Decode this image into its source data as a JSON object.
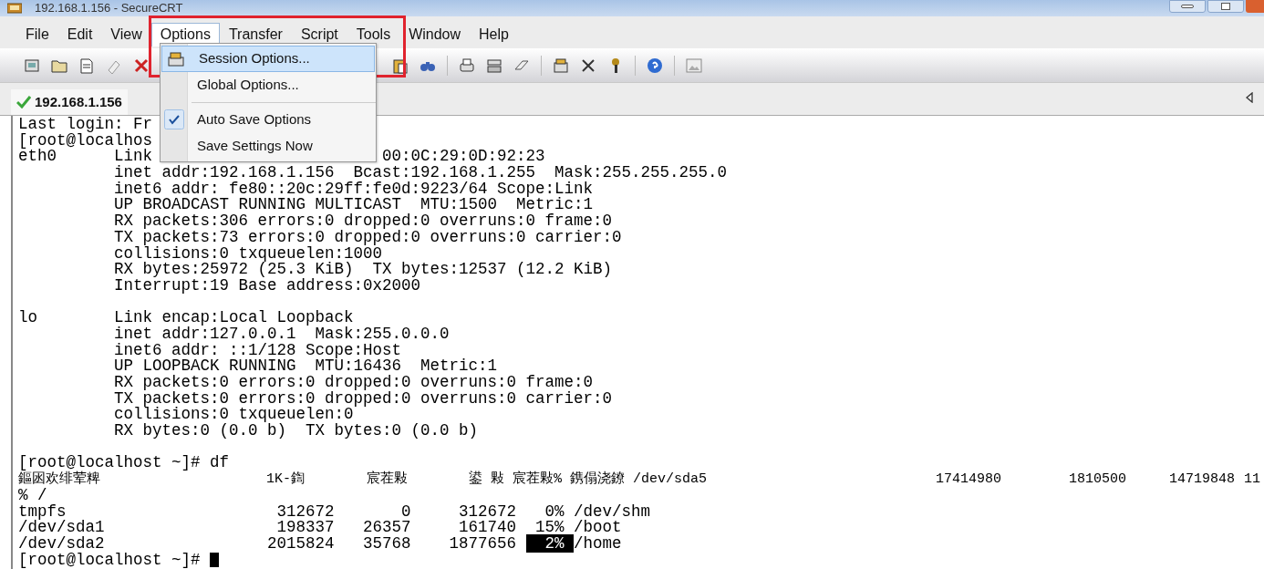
{
  "window": {
    "title": "192.168.1.156 - SecureCRT"
  },
  "menu_bar": [
    {
      "label": "File",
      "selected": false
    },
    {
      "label": "Edit",
      "selected": false
    },
    {
      "label": "View",
      "selected": false
    },
    {
      "label": "Options",
      "selected": true
    },
    {
      "label": "Transfer",
      "selected": false
    },
    {
      "label": "Script",
      "selected": false
    },
    {
      "label": "Tools",
      "selected": false
    },
    {
      "label": "Window",
      "selected": false
    },
    {
      "label": "Help",
      "selected": false
    }
  ],
  "options_menu": [
    {
      "kind": "item",
      "label": "Session Options...",
      "selected": true,
      "checked": false
    },
    {
      "kind": "item",
      "label": "Global Options...",
      "selected": false,
      "checked": false
    },
    {
      "kind": "separator"
    },
    {
      "kind": "item",
      "label": "Auto Save Options",
      "selected": false,
      "checked": true
    },
    {
      "kind": "item",
      "label": "Save Settings Now",
      "selected": false,
      "checked": false
    }
  ],
  "tabs": [
    {
      "label": "192.168.1.156",
      "selected": true,
      "connected": true
    }
  ],
  "terminal": {
    "lines": [
      {
        "kind": "text",
        "text": "Last login: Fr"
      },
      {
        "kind": "text",
        "text": "[root@localhos"
      },
      {
        "kind": "split",
        "parts": [
          "eth0      Link",
          "00:0C:29:0D:92:23"
        ]
      },
      {
        "kind": "text",
        "text": "          inet addr:192.168.1.156  Bcast:192.168.1.255  Mask:255.255.255.0"
      },
      {
        "kind": "text",
        "text": "          inet6 addr: fe80::20c:29ff:fe0d:9223/64 Scope:Link"
      },
      {
        "kind": "text",
        "text": "          UP BROADCAST RUNNING MULTICAST  MTU:1500  Metric:1"
      },
      {
        "kind": "text",
        "text": "          RX packets:306 errors:0 dropped:0 overruns:0 frame:0"
      },
      {
        "kind": "text",
        "text": "          TX packets:73 errors:0 dropped:0 overruns:0 carrier:0"
      },
      {
        "kind": "text",
        "text": "          collisions:0 txqueuelen:1000"
      },
      {
        "kind": "text",
        "text": "          RX bytes:25972 (25.3 KiB)  TX bytes:12537 (12.2 KiB)"
      },
      {
        "kind": "text",
        "text": "          Interrupt:19 Base address:0x2000"
      },
      {
        "kind": "blank"
      },
      {
        "kind": "text",
        "text": "lo        Link encap:Local Loopback"
      },
      {
        "kind": "text",
        "text": "          inet addr:127.0.0.1  Mask:255.0.0.0"
      },
      {
        "kind": "text",
        "text": "          inet6 addr: ::1/128 Scope:Host"
      },
      {
        "kind": "text",
        "text": "          UP LOOPBACK RUNNING  MTU:16436  Metric:1"
      },
      {
        "kind": "text",
        "text": "          RX packets:0 errors:0 dropped:0 overruns:0 frame:0"
      },
      {
        "kind": "text",
        "text": "          TX packets:0 errors:0 dropped:0 overruns:0 carrier:0"
      },
      {
        "kind": "text",
        "text": "          collisions:0 txqueuelen:0"
      },
      {
        "kind": "text",
        "text": "          RX bytes:0 (0.0 b)  TX bytes:0 (0.0 b)"
      },
      {
        "kind": "blank"
      },
      {
        "kind": "text",
        "text": "[root@localhost ~]# df"
      },
      {
        "kind": "columns",
        "parts": [
          "鏂囦欢绯荤粺",
          "1K-鍧",
          "宸茬敤",
          "鍙 敤 宸茬敤% 鎸傝浇鐐 /dev/sda5",
          "17414980",
          "1810500",
          "14719848",
          "11"
        ]
      },
      {
        "kind": "text",
        "text": "% /"
      },
      {
        "kind": "text",
        "text": "tmpfs                      312672       0     312672   0% /dev/shm"
      },
      {
        "kind": "text",
        "text": "/dev/sda1                  198337   26357     161740  15% /boot"
      },
      {
        "kind": "marked",
        "parts": [
          {
            "text": "/dev/sda2                 2015824   35768    1877656 ",
            "highlighted": false
          },
          {
            "text": "  2% ",
            "highlighted": true
          },
          {
            "text": "/home",
            "highlighted": false
          }
        ]
      },
      {
        "kind": "prompt",
        "text": "[root@localhost ~]# ",
        "cursor": true
      }
    ]
  }
}
